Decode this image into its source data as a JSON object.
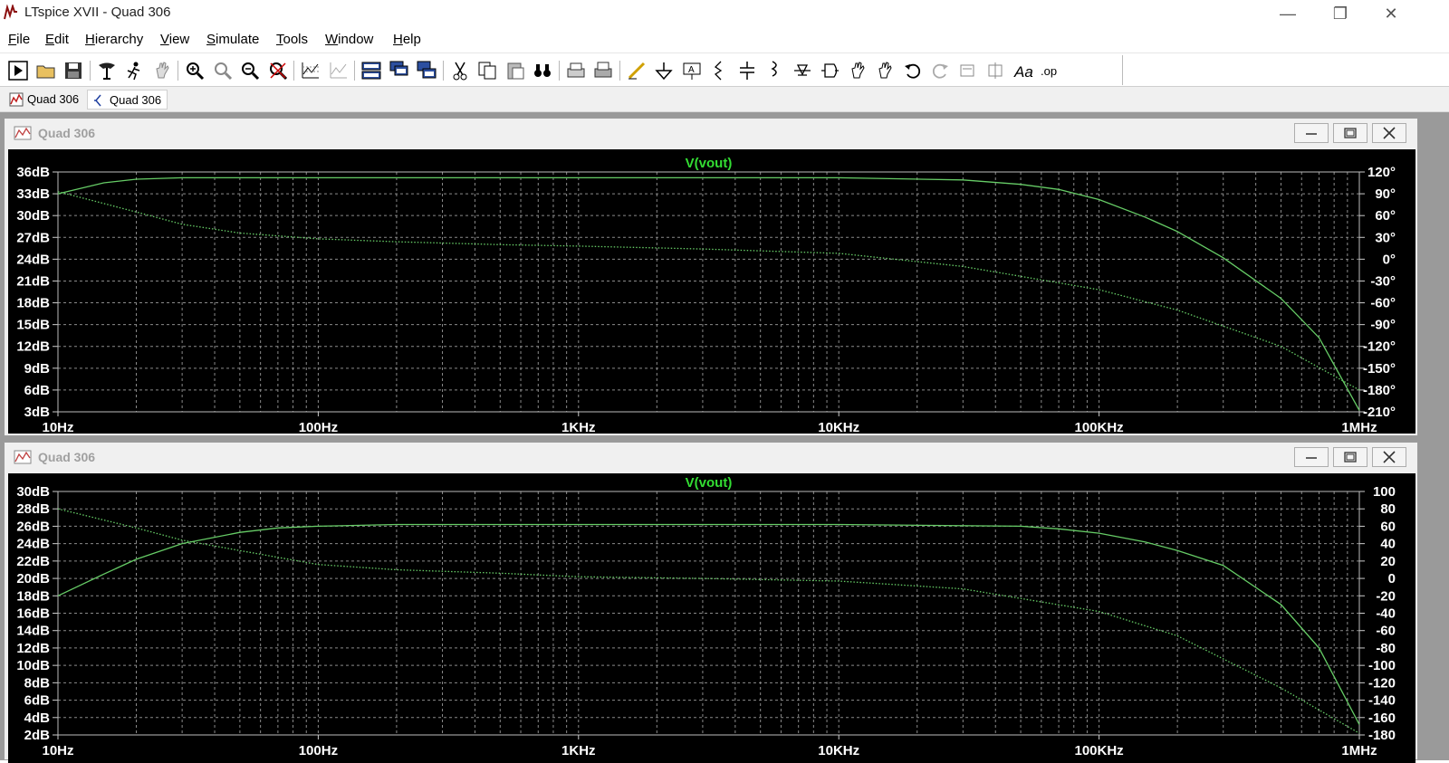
{
  "window": {
    "title": "LTspice XVII - Quad 306",
    "app_icon": "ltspice-logo-icon",
    "controls": [
      "minimize-icon",
      "restore-icon",
      "close-icon"
    ]
  },
  "menu": [
    "File",
    "Edit",
    "Hierarchy",
    "View",
    "Simulate",
    "Tools",
    "Window",
    "Help"
  ],
  "toolbar": {
    "icons": [
      "run-icon",
      "open-icon",
      "save-icon",
      "control-panel-icon",
      "halt-icon",
      "pan-hand-icon",
      "zoom-in-icon",
      "zoom-box-icon",
      "zoom-out-icon",
      "zoom-cancel-icon",
      "autorange-icon",
      "cursor-icon",
      "tile-horizontal-icon",
      "cascade-icon",
      "tile-vertical-icon",
      "cut-icon",
      "copy-icon",
      "paste-icon",
      "find-icon",
      "print-icon",
      "print-preview-icon",
      "draw-wire-icon",
      "ground-icon",
      "label-net-icon",
      "resistor-icon",
      "capacitor-icon",
      "inductor-icon",
      "diode-icon",
      "component-icon",
      "move-icon",
      "drag-icon",
      "undo-icon",
      "redo-icon",
      "rotate-icon",
      "mirror-icon",
      "text-icon",
      "spice-directive-icon"
    ]
  },
  "tabs": [
    {
      "label": "Quad 306",
      "icon": "waveform-tab-icon",
      "active": false
    },
    {
      "label": "Quad 306",
      "icon": "schematic-tab-icon",
      "active": true
    }
  ],
  "plots": [
    {
      "window_title": "Quad 306",
      "trace_label": "V(vout)",
      "x_ticks": [
        "10Hz",
        "100Hz",
        "1KHz",
        "10KHz",
        "100KHz",
        "1MHz"
      ],
      "y_left_ticks": [
        "36dB",
        "33dB",
        "30dB",
        "27dB",
        "24dB",
        "21dB",
        "18dB",
        "15dB",
        "12dB",
        "9dB",
        "6dB",
        "3dB"
      ],
      "y_right_ticks": [
        "120°",
        "90°",
        "60°",
        "30°",
        "0°",
        "-30°",
        "-60°",
        "-90°",
        "-120°",
        "-150°",
        "-180°",
        "-210°"
      ]
    },
    {
      "window_title": "Quad 306",
      "trace_label": "V(vout)",
      "x_ticks": [
        "10Hz",
        "100Hz",
        "1KHz",
        "10KHz",
        "100KHz",
        "1MHz"
      ],
      "y_left_ticks": [
        "30dB",
        "28dB",
        "26dB",
        "24dB",
        "22dB",
        "20dB",
        "18dB",
        "16dB",
        "14dB",
        "12dB",
        "10dB",
        "8dB",
        "6dB",
        "4dB",
        "2dB"
      ],
      "y_right_ticks": [
        "100",
        "80",
        "60",
        "40",
        "20",
        "0",
        "-20",
        "-40",
        "-60",
        "-80",
        "-100",
        "-120",
        "-140",
        "-160",
        "-180"
      ]
    }
  ],
  "colors": {
    "plot_bg": "#000000",
    "grid": "#8a8a8a",
    "axis_text": "#ffffff",
    "trace": "#66cc66",
    "trace_label": "#33dd33"
  },
  "chart_data": [
    {
      "type": "line",
      "title": "V(vout)",
      "x_scale": "log",
      "xlim": [
        10,
        1000000
      ],
      "ylim_left": [
        3,
        36
      ],
      "ylim_right": [
        -210,
        120
      ],
      "grid": true,
      "series": [
        {
          "axis": "left",
          "style": "solid",
          "x": [
            10,
            15,
            20,
            30,
            50,
            100,
            300,
            1000,
            3000,
            10000,
            30000,
            50000,
            70000,
            100000,
            150000,
            200000,
            300000,
            500000,
            700000,
            1000000
          ],
          "y": [
            33,
            34.5,
            35,
            35.2,
            35.2,
            35.2,
            35.2,
            35.2,
            35.2,
            35.2,
            34.9,
            34.3,
            33.6,
            32.2,
            29.8,
            27.8,
            24.2,
            18.6,
            13.2,
            3.2
          ]
        },
        {
          "axis": "right",
          "style": "dotted",
          "x": [
            10,
            20,
            30,
            50,
            100,
            200,
            500,
            1000,
            3000,
            10000,
            30000,
            100000,
            200000,
            500000,
            1000000
          ],
          "y": [
            93,
            65,
            48,
            36,
            28,
            24,
            20,
            18,
            14,
            8,
            -10,
            -42,
            -70,
            -120,
            -180
          ]
        }
      ]
    },
    {
      "type": "line",
      "title": "V(vout)",
      "x_scale": "log",
      "xlim": [
        10,
        1000000
      ],
      "ylim_left": [
        2,
        30
      ],
      "ylim_right": [
        -180,
        100
      ],
      "grid": true,
      "series": [
        {
          "axis": "left",
          "style": "solid",
          "x": [
            10,
            15,
            20,
            30,
            50,
            70,
            100,
            200,
            500,
            1000,
            10000,
            50000,
            70000,
            100000,
            150000,
            200000,
            300000,
            500000,
            700000,
            1000000
          ],
          "y": [
            18,
            20.5,
            22.2,
            24,
            25.3,
            25.8,
            26,
            26.2,
            26.2,
            26.2,
            26.2,
            26,
            25.7,
            25.2,
            24.2,
            23.2,
            21.5,
            17,
            12,
            3.2
          ]
        },
        {
          "axis": "right",
          "style": "dotted",
          "x": [
            10,
            20,
            30,
            50,
            100,
            200,
            500,
            1000,
            3000,
            10000,
            30000,
            100000,
            200000,
            500000,
            1000000
          ],
          "y": [
            80,
            58,
            44,
            32,
            16,
            10,
            6,
            2,
            0,
            -3,
            -12,
            -38,
            -66,
            -126,
            -178
          ]
        }
      ]
    }
  ]
}
